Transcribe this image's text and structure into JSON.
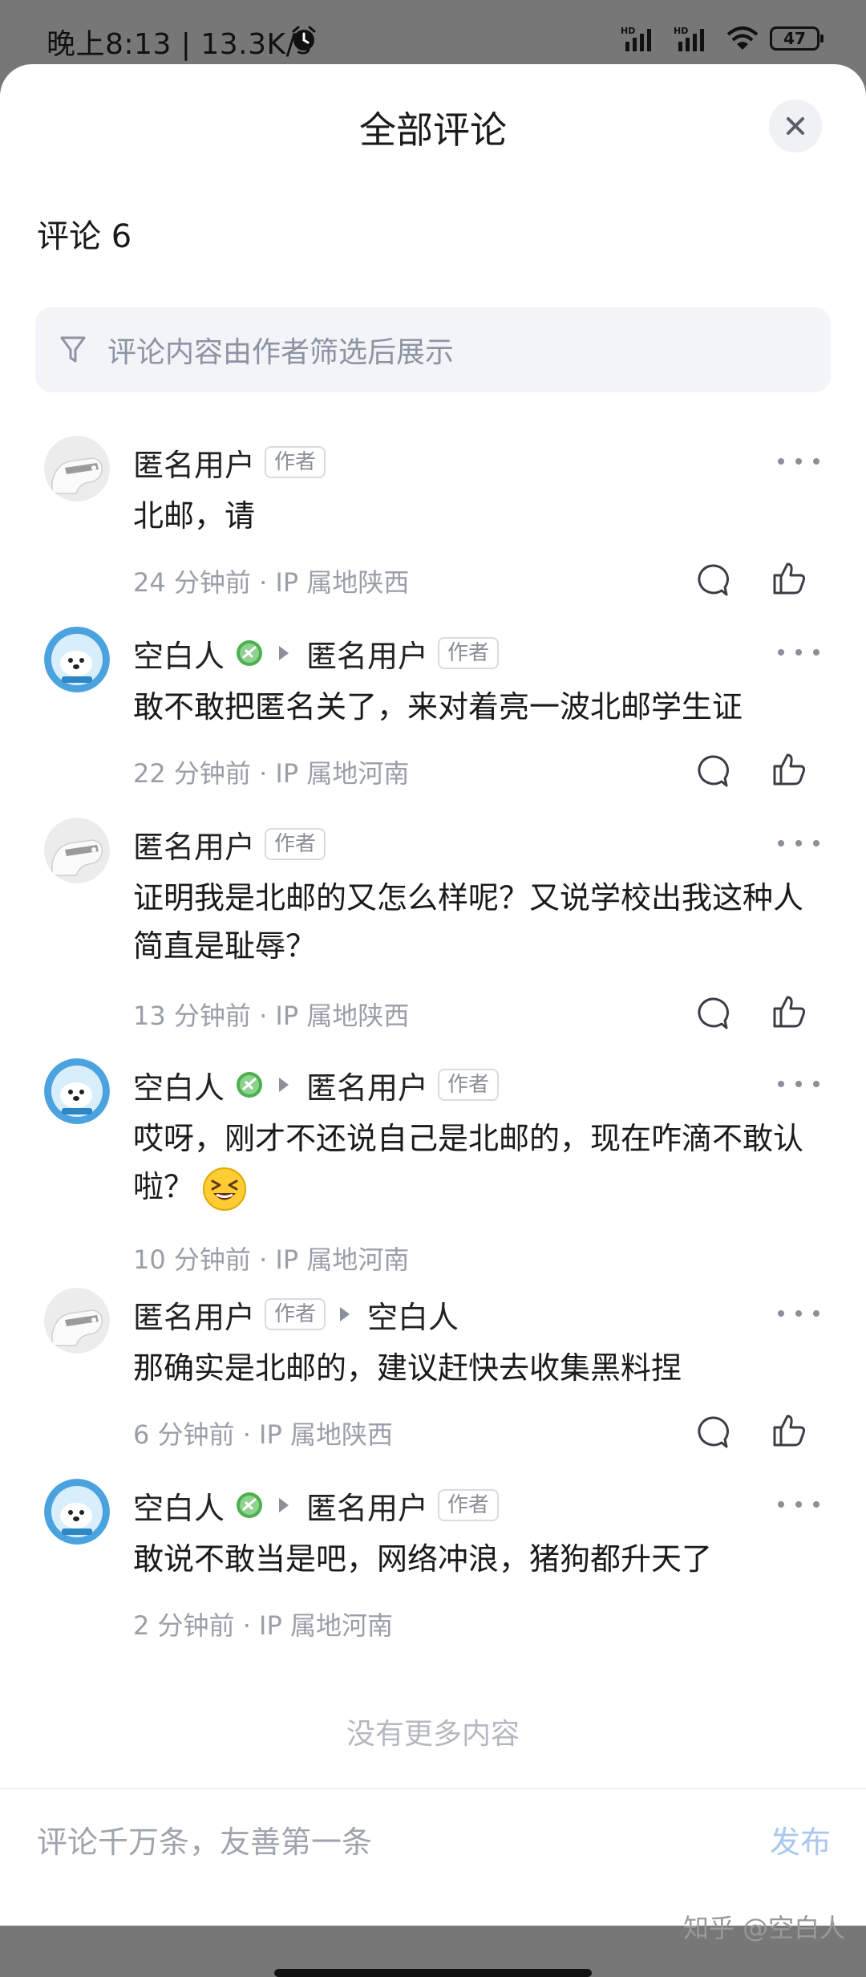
{
  "status_bar": {
    "time": "晚上8:13 | 13.3K/s",
    "battery": "47"
  },
  "sheet": {
    "title": "全部评论",
    "count_label": "评论 6",
    "filter_notice": "评论内容由作者筛选后展示"
  },
  "comments": [
    {
      "user": "匿名用户",
      "user_tag": "作者",
      "reply_to": "",
      "reply_to_tag": "",
      "text": "北邮，请",
      "meta": "24 分钟前 · IP 属地陕西"
    },
    {
      "user": "空白人",
      "user_tag": "",
      "reply_to": "匿名用户",
      "reply_to_tag": "作者",
      "text": "敢不敢把匿名关了，来对着亮一波北邮学生证",
      "meta": "22 分钟前 · IP 属地河南"
    },
    {
      "user": "匿名用户",
      "user_tag": "作者",
      "reply_to": "",
      "reply_to_tag": "",
      "text": "证明我是北邮的又怎么样呢？又说学校出我这种人简直是耻辱？",
      "meta": "13 分钟前 · IP 属地陕西"
    },
    {
      "user": "空白人",
      "user_tag": "",
      "reply_to": "匿名用户",
      "reply_to_tag": "作者",
      "text": "哎呀，刚才不还说自己是北邮的，现在咋滴不敢认啦？",
      "meta": "10 分钟前 · IP 属地河南"
    },
    {
      "user": "匿名用户",
      "user_tag": "作者",
      "reply_to": "空白人",
      "reply_to_tag": "",
      "text": "那确实是北邮的，建议赶快去收集黑料捏",
      "meta": "6 分钟前 · IP 属地陕西"
    },
    {
      "user": "空白人",
      "user_tag": "",
      "reply_to": "匿名用户",
      "reply_to_tag": "作者",
      "text": "敢说不敢当是吧，网络冲浪，猪狗都升天了",
      "meta": "2 分钟前 · IP 属地河南"
    }
  ],
  "end_text": "没有更多内容",
  "input": {
    "placeholder": "评论千万条，友善第一条",
    "publish_label": "发布"
  },
  "watermark": "知乎 @空白人",
  "colors": {
    "accent_publish": "#a9c7ef",
    "meta_gray": "#9a9ea8",
    "avatar_blue": "#4aa3df"
  }
}
